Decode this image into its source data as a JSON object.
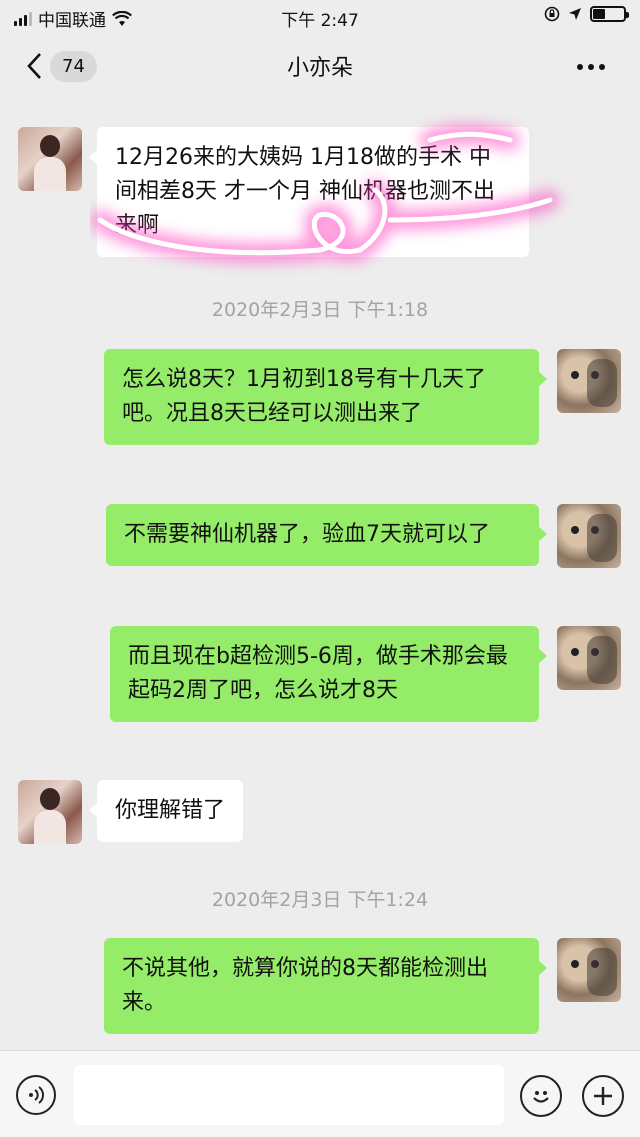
{
  "status_bar": {
    "carrier": "中国联通",
    "time": "下午 2:47",
    "icons": [
      "signal-icon",
      "wifi-icon",
      "rotation-lock-icon",
      "location-icon",
      "battery-icon"
    ],
    "battery_level": 0.4
  },
  "nav": {
    "back_icon": "chevron-left-icon",
    "unread_count": "74",
    "title": "小亦朵",
    "more_icon": "more-icon"
  },
  "messages": [
    {
      "side": "left",
      "text": "12月26来的大姨妈  1月18做的手术  中间相差8天 才一个月 神仙机器也测不出来啊"
    },
    {
      "type": "timestamp",
      "text": "2020年2月3日 下午1:18"
    },
    {
      "side": "right",
      "text": "怎么说8天？1月初到18号有十几天了吧。况且8天已经可以测出来了"
    },
    {
      "side": "right",
      "text": "不需要神仙机器了，验血7天就可以了"
    },
    {
      "side": "right",
      "text": "而且现在b超检测5-6周，做手术那会最起码2周了吧，怎么说才8天"
    },
    {
      "side": "left",
      "text": "你理解错了"
    },
    {
      "type": "timestamp",
      "text": "2020年2月3日 下午1:24"
    },
    {
      "side": "right",
      "text": "不说其他，就算你说的8天都能检测出来。"
    }
  ],
  "input_bar": {
    "voice_icon": "voice-icon",
    "input_value": "",
    "emoji_icon": "emoji-icon",
    "plus_icon": "plus-icon"
  },
  "colors": {
    "background": "#ededed",
    "bubble_self": "#95ec69",
    "bubble_other": "#ffffff",
    "scribble": "#ff4fc8"
  }
}
